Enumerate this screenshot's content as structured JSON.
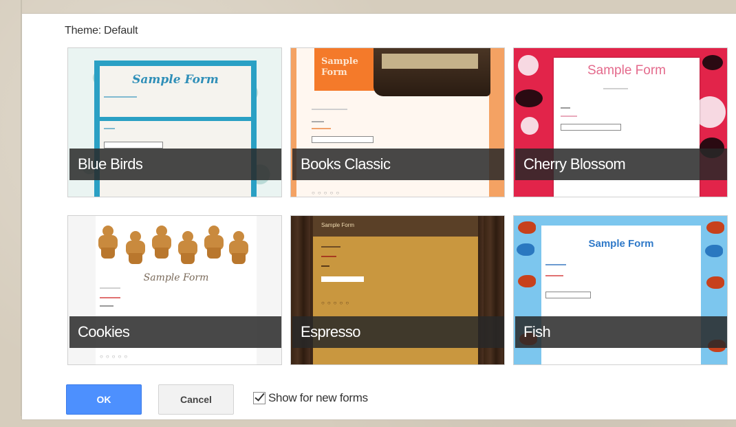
{
  "theme_label": {
    "prefix": "Theme:",
    "value": "Default"
  },
  "themes": [
    {
      "name": "Blue Birds",
      "sample_title": "Sample Form"
    },
    {
      "name": "Books Classic",
      "sample_title_line1": "Sample",
      "sample_title_line2": "Form"
    },
    {
      "name": "Cherry Blossom",
      "sample_title": "Sample Form"
    },
    {
      "name": "Cookies",
      "sample_title": "Sample Form"
    },
    {
      "name": "Espresso",
      "sample_title": "Sample Form"
    },
    {
      "name": "Fish",
      "sample_title": "Sample Form"
    }
  ],
  "footer": {
    "ok_label": "OK",
    "cancel_label": "Cancel",
    "show_new_label": "Show for new forms",
    "show_new_checked": true
  },
  "colors": {
    "ok_button": "#4d90fe",
    "caption_bg": "#282828"
  }
}
